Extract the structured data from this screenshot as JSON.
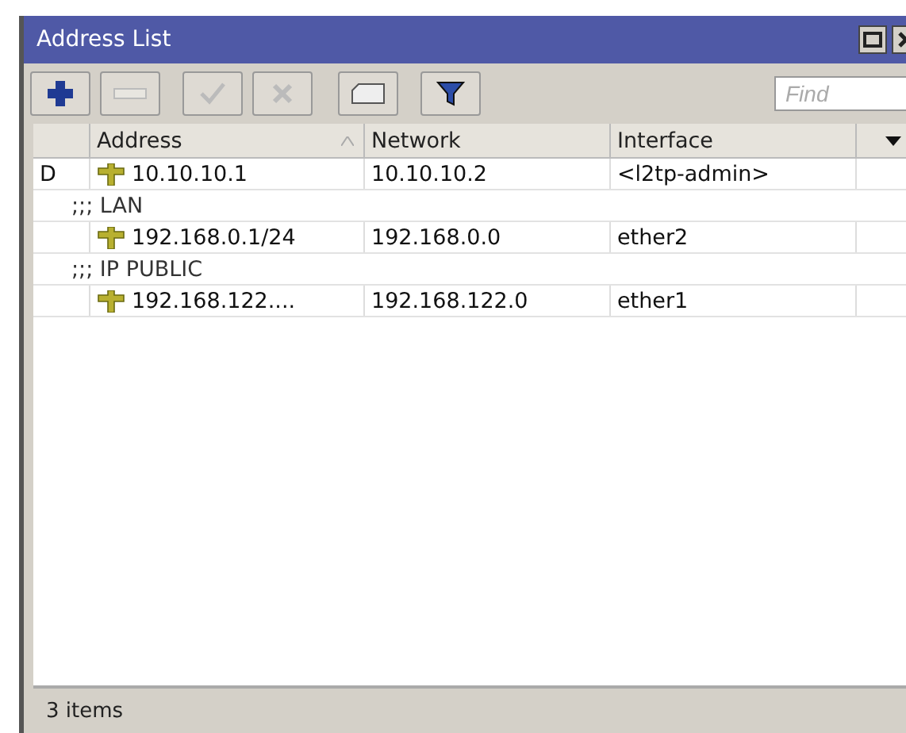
{
  "window": {
    "title": "Address List"
  },
  "toolbar": {
    "buttons": [
      {
        "kind": "add",
        "disabled": false
      },
      {
        "kind": "remove",
        "disabled": true
      },
      {
        "kind": "enable",
        "disabled": true
      },
      {
        "kind": "disable",
        "disabled": true
      },
      {
        "kind": "comment",
        "disabled": false
      },
      {
        "kind": "filter",
        "disabled": false
      }
    ],
    "search": {
      "placeholder": "Find"
    }
  },
  "table": {
    "columns": [
      "Address",
      "Network",
      "Interface"
    ],
    "rows": [
      {
        "kind": "entry",
        "flag": "D",
        "address": "10.10.10.1",
        "network": "10.10.10.2",
        "interface": "<l2tp-admin>"
      },
      {
        "kind": "comment",
        "text": ";;; LAN"
      },
      {
        "kind": "entry",
        "address": "192.168.0.1/24",
        "network": "192.168.0.0",
        "interface": "ether2"
      },
      {
        "kind": "comment",
        "text": ";;; IP PUBLIC"
      },
      {
        "kind": "entry",
        "address": "192.168.122....",
        "network": "192.168.122.0",
        "interface": "ether1"
      }
    ]
  },
  "status_bar": "3 items"
}
